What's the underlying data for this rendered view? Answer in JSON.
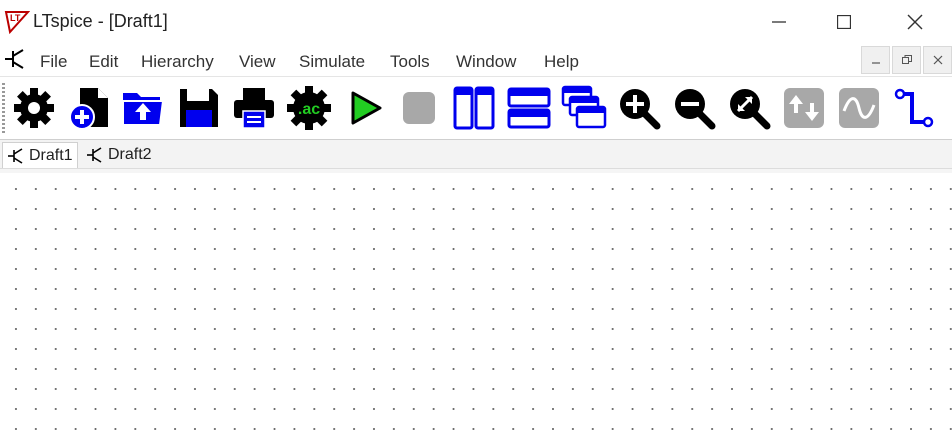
{
  "window": {
    "title": "LTspice - [Draft1]",
    "controls": {
      "minimize": "minimize",
      "maximize": "maximize",
      "close": "close"
    }
  },
  "menu": {
    "items": [
      "File",
      "Edit",
      "Hierarchy",
      "View",
      "Simulate",
      "Tools",
      "Window",
      "Help"
    ]
  },
  "toolbar": {
    "buttons": [
      {
        "name": "settings",
        "icon": "gear-icon",
        "highlighted": true
      },
      {
        "name": "new-schematic",
        "icon": "new-document-icon"
      },
      {
        "name": "open",
        "icon": "open-folder-icon"
      },
      {
        "name": "save",
        "icon": "floppy-disk-icon"
      },
      {
        "name": "print",
        "icon": "printer-icon"
      },
      {
        "name": "edit-simulation",
        "icon": "ac-gear-icon",
        "label": ".ac"
      },
      {
        "name": "run",
        "icon": "play-icon"
      },
      {
        "name": "halt",
        "icon": "stop-icon",
        "disabled": true
      },
      {
        "name": "tile-vertical",
        "icon": "tile-vertical-icon"
      },
      {
        "name": "tile-horizontal",
        "icon": "tile-horizontal-icon"
      },
      {
        "name": "cascade",
        "icon": "cascade-icon"
      },
      {
        "name": "zoom-in",
        "icon": "zoom-in-icon"
      },
      {
        "name": "zoom-out",
        "icon": "zoom-out-icon"
      },
      {
        "name": "zoom-fit",
        "icon": "zoom-fit-icon"
      },
      {
        "name": "autorange",
        "icon": "autorange-icon",
        "disabled": true
      },
      {
        "name": "add-trace",
        "icon": "waveform-icon",
        "disabled": true
      },
      {
        "name": "draw-wire",
        "icon": "wire-icon"
      }
    ],
    "colors": {
      "accent": "#0000ee",
      "highlight": "#ffff33",
      "run": "#22cc22",
      "ac_green": "#22cc22",
      "disabled": "#a8a8a8"
    }
  },
  "tabs": [
    {
      "label": "Draft1",
      "active": true
    },
    {
      "label": "Draft2",
      "active": false
    }
  ]
}
